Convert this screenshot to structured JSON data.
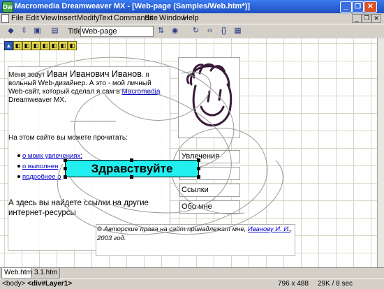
{
  "window": {
    "title": "Macromedia Dreamweaver MX - [Web-page (Samples/Web.htm*)]",
    "app_icon": "Dw"
  },
  "menubar": {
    "items": [
      "File",
      "Edit",
      "View",
      "Insert",
      "Modify",
      "Text",
      "Commands",
      "Site",
      "Window",
      "Help"
    ]
  },
  "toolbar": {
    "title_label": "Title:",
    "title_value": "Web-page"
  },
  "document": {
    "intro_prefix": "Меня зовут ",
    "author_name": "Иван Иванович Иванов",
    "intro_mid": ". я вольный Web-дизайнер. А это - мой личный Web-сайт, который сделал я сам в ",
    "intro_link": "Macromedia",
    "intro_suffix": " Dreamweaver MX.",
    "can_read": "На этом сайте вы можете прочитать:",
    "links": [
      "о моих увлечениях;",
      "о выполнен",
      "подробнее о"
    ],
    "more_text": "А здесь вы найдете ссылки на другие интернет-ресурсы",
    "nav": [
      "Увлечения",
      "кты",
      "Ссылки",
      "Обо мне"
    ],
    "copyright_prefix": "© Авторские права на сайт принадлежат мне, ",
    "copyright_link": "Иванову И. И.",
    "copyright_suffix": ", 2003 год.",
    "hello_layer": "Здравствуйте"
  },
  "tabs": [
    "Web.htm *",
    "3.1.htm"
  ],
  "status": {
    "tag_body": "<body>",
    "tag_layer": "<div#Layer1>",
    "window_size": "796 x 488",
    "file_size": "29K / 8 sec"
  }
}
